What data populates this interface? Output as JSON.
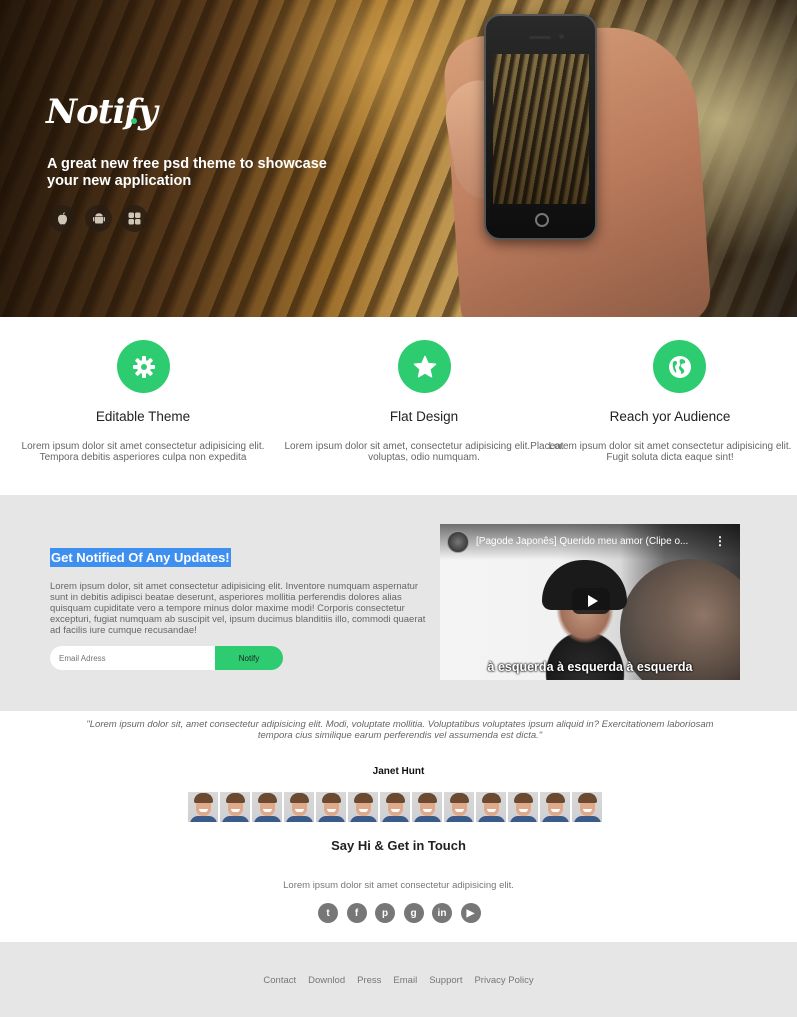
{
  "hero": {
    "logo": "Notify",
    "tagline": "A great new free psd theme to showcase your new application",
    "store_icons": [
      "apple-icon",
      "android-icon",
      "windows-icon"
    ]
  },
  "features": [
    {
      "icon": "gear-icon",
      "title": "Editable Theme",
      "text": "Lorem ipsum dolor sit amet consectetur adipisicing elit. Tempora debitis asperiores culpa non expedita"
    },
    {
      "icon": "star-icon",
      "title": "Flat Design",
      "text": "Lorem ipsum dolor sit amet, consectetur adipisicing elit.Placeat voluptas, odio numquam."
    },
    {
      "icon": "globe-icon",
      "title": "Reach yor Audience",
      "text": "Lorem ipsum dolor sit amet consectetur adipisicing elit. Fugit soluta dicta eaque sint!"
    }
  ],
  "signup": {
    "title": "Get Notified Of Any Updates!",
    "text": "Lorem ipsum dolor, sit amet consectetur adipisicing elit. Inventore numquam aspernatur sunt in debitis adipisci beatae deserunt, asperiores mollitia perferendis dolores alias quisquam cupiditate vero a tempore minus dolor maxime modi! Corporis consectetur excepturi, fugiat numquam ab suscipit vel, ipsum ducimus blanditiis illo, commodi quaerat ad facilis iure cumque recusandae!",
    "email_placeholder": "Email Adress",
    "button": "Notify"
  },
  "video": {
    "title": "[Pagode Japonês] Querido meu amor (Clipe o...",
    "subtitle": "à esquerda à esquerda à esquerda"
  },
  "testimonial": {
    "quote": "\"Lorem ipsum dolor sit, amet consectetur adipisicing elit. Modi, voluptate mollitia. Voluptatibus voluptates ipsum aliquid in? Exercitationem laboriosam tempora cius similique earum perferendis vel assumenda est dicta.\"",
    "author": "Janet Hunt",
    "avatar_count": 13
  },
  "contact": {
    "title": "Say Hi & Get in Touch",
    "text": "Lorem ipsum dolor sit amet consectetur adipisicing elit.",
    "socials": [
      {
        "icon": "twitter-icon",
        "glyph": "t"
      },
      {
        "icon": "facebook-icon",
        "glyph": "f"
      },
      {
        "icon": "pinterest-icon",
        "glyph": "p"
      },
      {
        "icon": "google-plus-icon",
        "glyph": "g"
      },
      {
        "icon": "linkedin-icon",
        "glyph": "in"
      },
      {
        "icon": "youtube-icon",
        "glyph": "▶"
      }
    ]
  },
  "footer": {
    "links": [
      "Contact",
      "Downlod",
      "Press",
      "Email",
      "Support",
      "Privacy Policy"
    ]
  },
  "colors": {
    "accent": "#2ecc71",
    "highlight": "#3d8ff0",
    "section_gray": "#e6e6e6"
  }
}
